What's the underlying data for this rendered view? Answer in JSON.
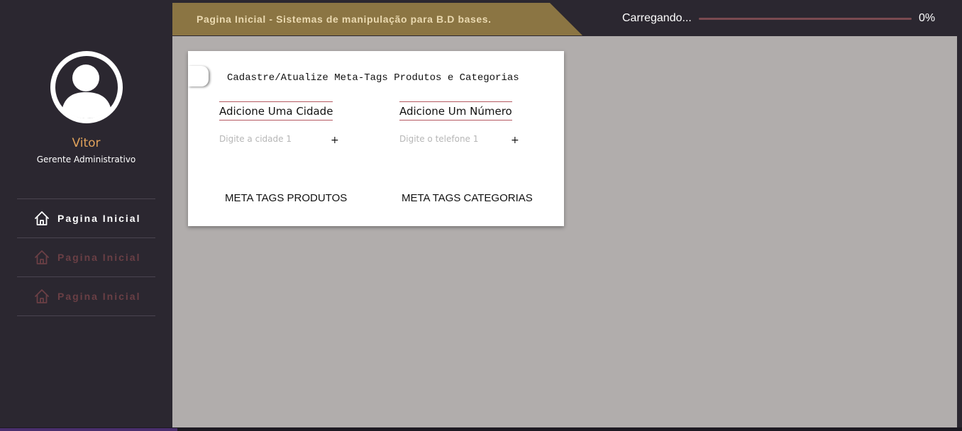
{
  "header": {
    "title": "Pagina Inicial - Sistemas de manipulação para B.D bases.",
    "loading_label": "Carregando...",
    "progress_fraction": 0.0,
    "progress_text": "0%"
  },
  "user": {
    "name": "Vitor",
    "role": "Gerente Administrativo",
    "avatar_icon": "user-circle-icon"
  },
  "sidebar": {
    "items": [
      {
        "label": "Pagina Inicial",
        "icon": "home-icon",
        "state": "active"
      },
      {
        "label": "Pagina Inicial",
        "icon": "home-icon",
        "state": "muted"
      },
      {
        "label": "Pagina Inicial",
        "icon": "home-icon",
        "state": "muted"
      }
    ]
  },
  "card": {
    "title": "Cadastre/Atualize Meta-Tags Produtos e Categorias",
    "city": {
      "heading": "Adicione Uma Cidade",
      "placeholder": "Digite a cidade 1",
      "value": "",
      "add_label": "+"
    },
    "phone": {
      "heading": "Adicione Um Número",
      "placeholder": "Digite o telefone 1",
      "value": "",
      "add_label": "+"
    },
    "meta_products_label": "META TAGS PRODUTOS",
    "meta_categories_label": "META TAGS CATEGORIAS"
  },
  "colors": {
    "sidebar_bg": "#2b2730",
    "banner_bg": "#8b7543",
    "banner_text": "#ead9b0",
    "user_name": "#e0a25b",
    "main_bg": "#b1adac",
    "accent_line": "#b55a62",
    "muted_nav": "#6a3f45"
  }
}
